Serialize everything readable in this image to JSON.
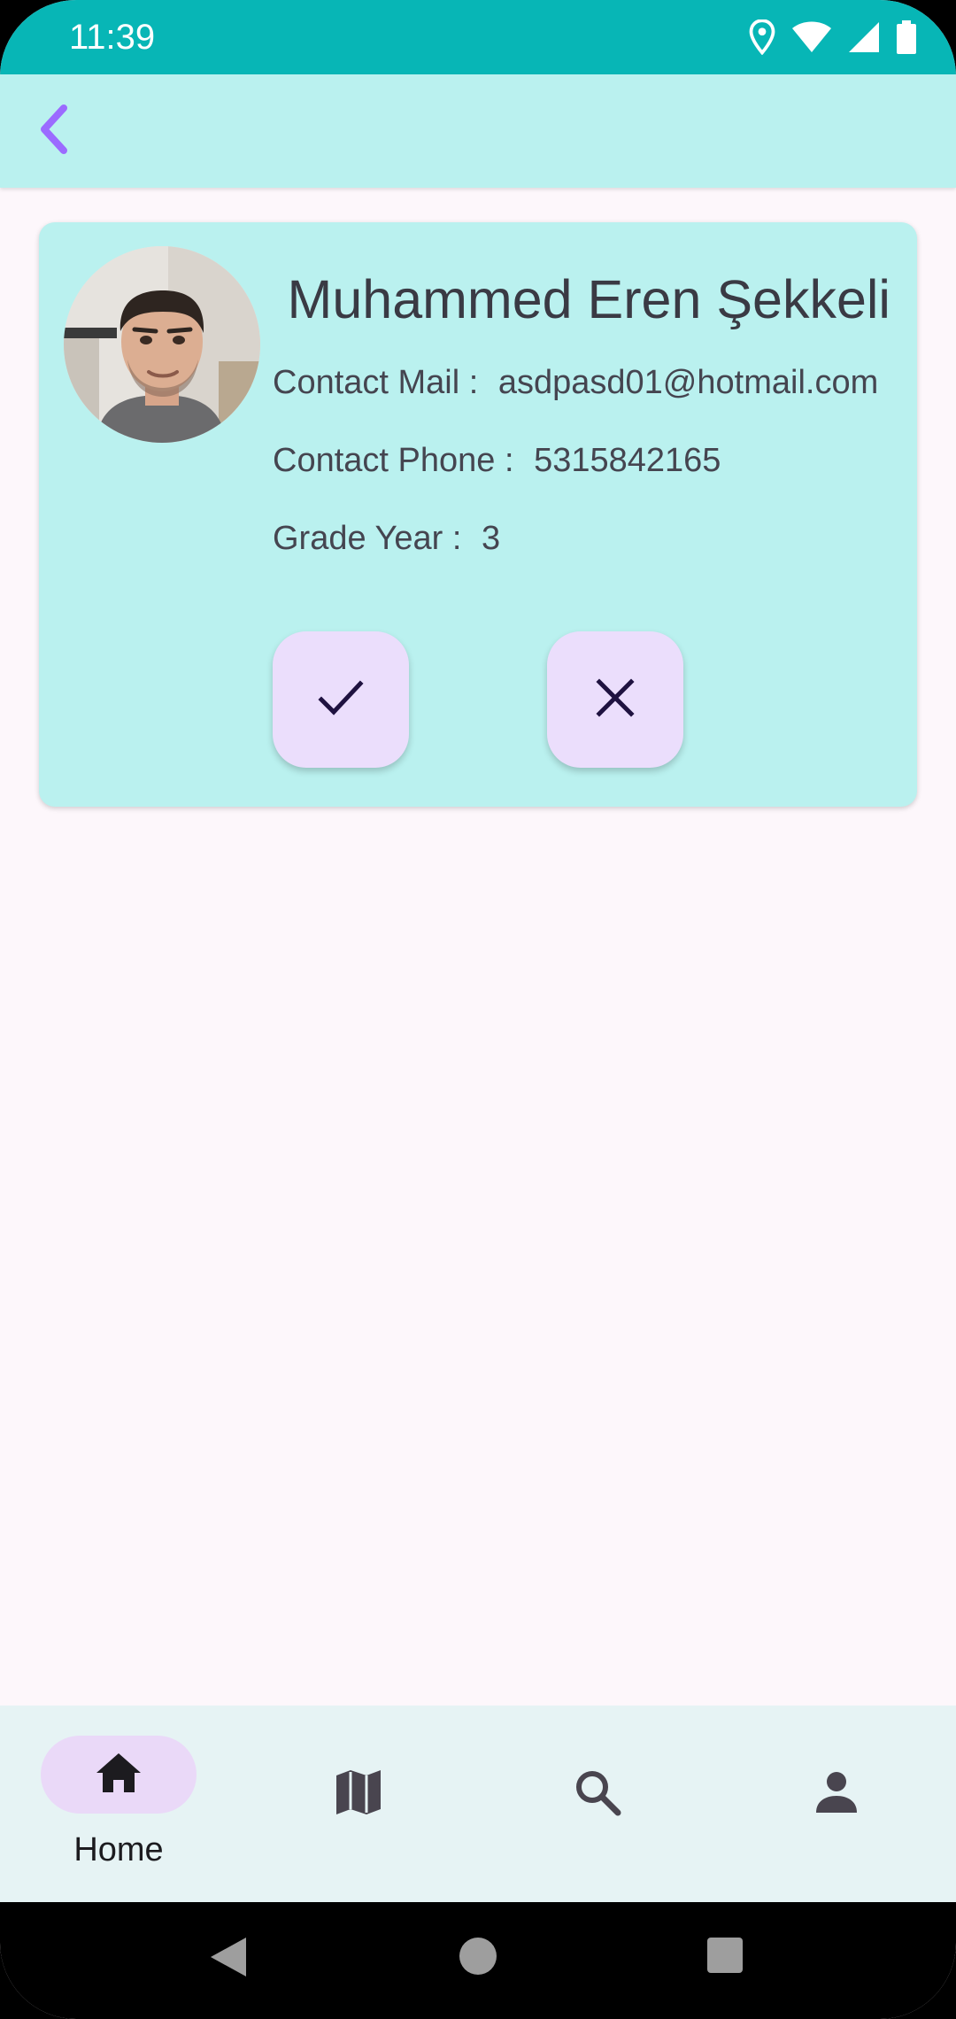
{
  "status_bar": {
    "time": "11:39",
    "icons": [
      "location-icon",
      "wifi-icon",
      "signal-icon",
      "battery-icon"
    ]
  },
  "app_bar": {
    "back_icon": "chevron-left-icon",
    "accent_color": "#9b6bff"
  },
  "request_card": {
    "name": "Muhammed Eren Şekkeli",
    "avatar_icon": "profile-photo",
    "contact_mail_label": "Contact Mail :",
    "contact_mail_value": "asdpasd01@hotmail.com",
    "contact_phone_label": "Contact Phone :",
    "contact_phone_value": "5315842165",
    "grade_year_label": "Grade Year :",
    "grade_year_value": "3",
    "accept_icon": "check-icon",
    "reject_icon": "close-icon",
    "card_color": "#baf1ef",
    "button_color": "#ebdefc"
  },
  "bottom_nav": {
    "items": [
      {
        "icon": "home-icon",
        "label": "Home",
        "selected": true
      },
      {
        "icon": "map-icon",
        "label": "",
        "selected": false
      },
      {
        "icon": "search-icon",
        "label": "",
        "selected": false
      },
      {
        "icon": "person-icon",
        "label": "",
        "selected": false
      }
    ]
  },
  "system_nav": {
    "icons": [
      "back-triangle-icon",
      "home-circle-icon",
      "recents-square-icon"
    ]
  }
}
